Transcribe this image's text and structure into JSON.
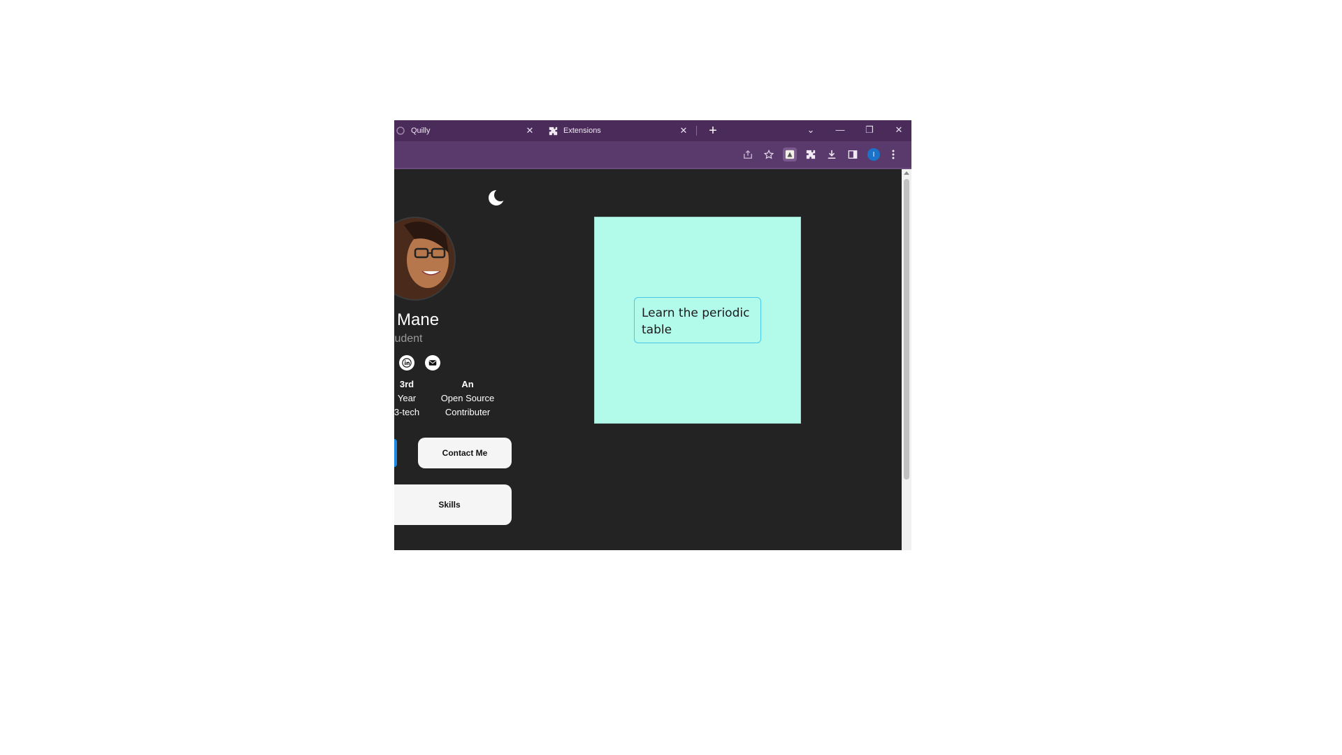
{
  "tabs": [
    {
      "label": "Quilly",
      "close": "✕"
    },
    {
      "label": "Extensions",
      "close": "✕"
    }
  ],
  "new_tab": "+",
  "window_controls": {
    "dropdown": "⌄",
    "minimize": "—",
    "restore": "❐",
    "close": "✕"
  },
  "toolbar": {
    "profile_initial": "I"
  },
  "profile": {
    "name": "Mane",
    "role": "tudent",
    "stats": [
      {
        "top": "3rd",
        "line1": "Year",
        "line2": "3-tech"
      },
      {
        "top": "An",
        "line1": "Open Source",
        "line2": "Contributer"
      }
    ],
    "contact_label": "Contact Me",
    "skills_label": "Skills"
  },
  "sticky_note": {
    "text": "Learn the periodic table",
    "color": "#b2fbeb"
  },
  "colors": {
    "tab_bar": "#4a2b5a",
    "toolbar": "#5a3a6c",
    "page_bg": "#232323",
    "accent_blue": "#1e88e5"
  }
}
